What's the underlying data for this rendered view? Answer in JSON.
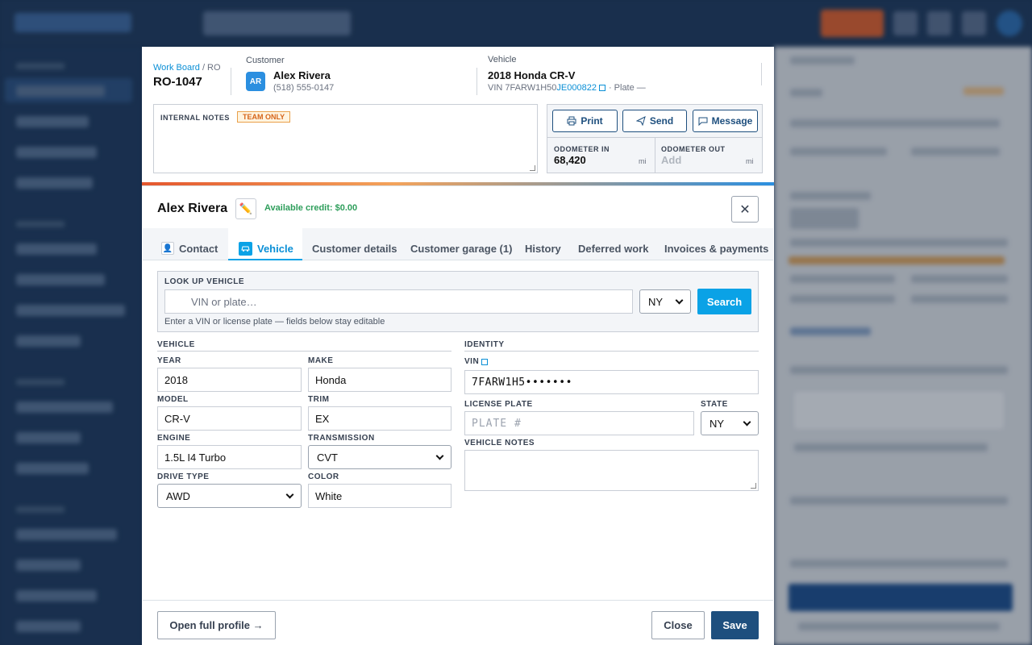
{
  "ro": {
    "breadcrumb_link": "Work Board",
    "breadcrumb_sep": "/ RO",
    "number": "RO-1047",
    "customer_caption": "Customer",
    "customer_initials": "AR",
    "customer_name": "Alex Rivera",
    "customer_phone": "(518) 555-0147",
    "vehicle_caption": "Vehicle",
    "vehicle_name": "2018 Honda CR-V",
    "vin_prefix": "VIN 7FARW1H50",
    "vin_link": "JE000822",
    "plate": "· Plate —",
    "notes_label": "INTERNAL NOTES",
    "notes_badge": "TEAM ONLY",
    "print_label": "Print",
    "send_label": "Send",
    "message_label": "Message",
    "odo_in_label": "ODOMETER IN",
    "odo_in_value": "68,420",
    "odo_in_unit": "mi",
    "odo_out_label": "ODOMETER OUT",
    "odo_out_placeholder": "Add",
    "odo_out_unit": "mi"
  },
  "modal": {
    "title": "Alex Rivera",
    "credit": "Available credit: $0.00",
    "tabs": [
      {
        "label": "Contact"
      },
      {
        "label": "Vehicle"
      },
      {
        "label": "Customer details"
      },
      {
        "label": "Customer garage (1)"
      },
      {
        "label": "History"
      },
      {
        "label": "Deferred work"
      },
      {
        "label": "Invoices & payments"
      }
    ],
    "lookup": {
      "label": "LOOK UP VEHICLE",
      "placeholder": "VIN or plate…",
      "state": "NY",
      "search_label": "Search",
      "hint": "Enter a VIN or license plate — fields below stay editable"
    },
    "vehicle": {
      "section": "VEHICLE",
      "year_label": "YEAR",
      "year": "2018",
      "make_label": "MAKE",
      "make": "Honda",
      "model_label": "MODEL",
      "model": "CR-V",
      "trim_label": "TRIM",
      "trim": "EX",
      "engine_label": "ENGINE",
      "engine": "1.5L I4 Turbo",
      "transmission_label": "TRANSMISSION",
      "transmission": "CVT",
      "drive_label": "DRIVE TYPE",
      "drive": "AWD",
      "color_label": "COLOR",
      "color": "White"
    },
    "identity": {
      "section": "IDENTITY",
      "vin_label": "VIN",
      "vin": "7FARW1H5•••••••",
      "plate_label": "LICENSE PLATE",
      "plate_placeholder": "PLATE #",
      "state_label": "STATE",
      "state": "NY",
      "notes_label": "VEHICLE NOTES"
    },
    "footer": {
      "open_profile": "Open full profile →",
      "close": "Close",
      "save": "Save"
    }
  },
  "colors": {
    "accent": "#0aa2e6",
    "navy": "#1e4f7e",
    "credit_green": "#2e9e5b",
    "badge_orange": "#e07b16"
  }
}
